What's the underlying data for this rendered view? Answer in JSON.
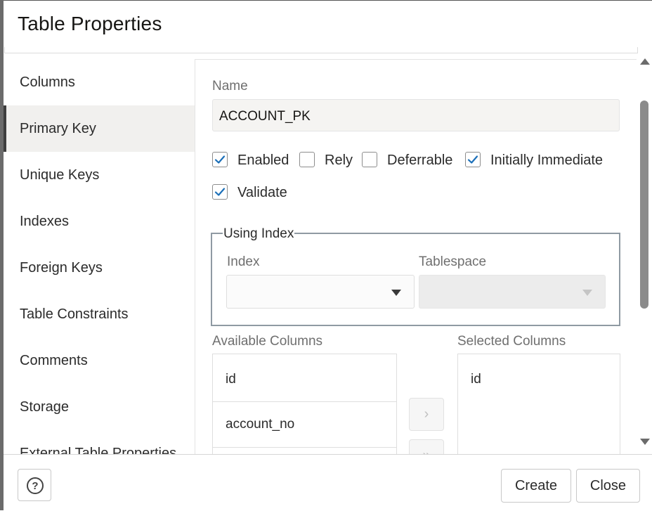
{
  "dialog": {
    "title": "Table Properties"
  },
  "nav": {
    "items": [
      {
        "label": "Columns",
        "active": false
      },
      {
        "label": "Primary Key",
        "active": true
      },
      {
        "label": "Unique Keys",
        "active": false
      },
      {
        "label": "Indexes",
        "active": false
      },
      {
        "label": "Foreign Keys",
        "active": false
      },
      {
        "label": "Table Constraints",
        "active": false
      },
      {
        "label": "Comments",
        "active": false
      },
      {
        "label": "Storage",
        "active": false
      },
      {
        "label": "External Table Properties",
        "active": false
      }
    ]
  },
  "primary_key": {
    "name_label": "Name",
    "name_value": "ACCOUNT_PK",
    "checkboxes": [
      {
        "label": "Enabled",
        "checked": true
      },
      {
        "label": "Rely",
        "checked": false
      },
      {
        "label": "Deferrable",
        "checked": false
      },
      {
        "label": "Initially Immediate",
        "checked": true
      },
      {
        "label": "Validate",
        "checked": true
      }
    ],
    "using_index": {
      "legend": "Using Index",
      "index_label": "Index",
      "index_value": "",
      "tablespace_label": "Tablespace",
      "tablespace_value": ""
    },
    "available_columns": {
      "label": "Available Columns",
      "items": [
        "id",
        "account_no"
      ]
    },
    "selected_columns": {
      "label": "Selected Columns",
      "items": [
        "id"
      ]
    },
    "shuttle": {
      "move_one": "›",
      "move_all": "»"
    }
  },
  "footer": {
    "help_label": "?",
    "create_label": "Create",
    "close_label": "Close"
  },
  "colors": {
    "accent_check": "#1b6fb8",
    "active_nav_bg": "#f1f0ee",
    "input_bg": "#f5f4f2"
  }
}
